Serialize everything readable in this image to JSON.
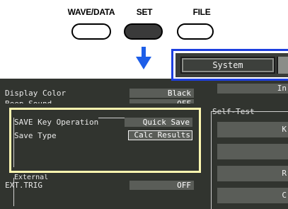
{
  "hardware": {
    "wave_data_label": "WAVE/DATA",
    "set_label": "SET",
    "file_label": "FILE"
  },
  "tab": {
    "system_label": "System"
  },
  "settings": {
    "display_color": {
      "label": "Display Color",
      "value": "Black"
    },
    "beep_sound": {
      "label": "Beep Sound",
      "value": "OFF"
    },
    "save_key_operation": {
      "label": "SAVE Key Operation",
      "value": "Quick Save"
    },
    "save_type": {
      "label": "Save Type",
      "value": "Calc Results"
    },
    "external_label": "External",
    "ext_trig": {
      "label": "EXT.TRIG",
      "value": "OFF"
    }
  },
  "right_panel": {
    "top_button": "In",
    "self_test_label": "Self-Test",
    "buttons": [
      "K",
      "",
      "R",
      "C"
    ]
  },
  "colors": {
    "highlight_border": "#fff7b0",
    "tab_border": "#1d3fe0",
    "arrow": "#1d5ee8",
    "screen_bg": "#31342f"
  }
}
